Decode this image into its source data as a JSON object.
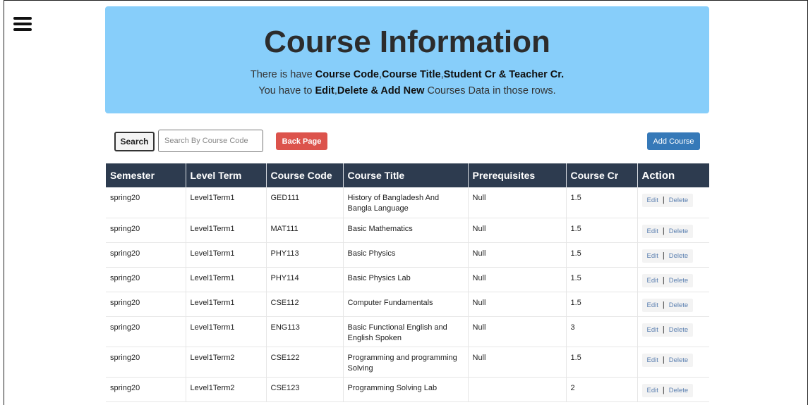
{
  "menu": {
    "icon": "hamburger-menu-icon"
  },
  "hero": {
    "title": "Course Information",
    "line1_pre": "There is have ",
    "line1_b1": "Course Code",
    "line1_c1": ",",
    "line1_b2": "Course Title",
    "line1_c2": ",",
    "line1_b3": "Student Cr & Teacher Cr.",
    "line2_pre": "You have to ",
    "line2_b1": "Edit",
    "line2_c1": ",",
    "line2_b2": "Delete & Add New",
    "line2_post": " Courses Data in those rows."
  },
  "toolbar": {
    "search_label": "Search",
    "search_placeholder": "Search By Course Code",
    "back_label": "Back Page",
    "add_label": "Add Course"
  },
  "table": {
    "headers": [
      "Semester",
      "Level Term",
      "Course Code",
      "Course Title",
      "Prerequisites",
      "Course Cr",
      "Action"
    ],
    "edit_label": "Edit",
    "separator": "|",
    "delete_label": "Delete",
    "rows": [
      {
        "semester": "spring20",
        "level": "Level1Term1",
        "code": "GED111",
        "title": "History of Bangladesh And Bangla Language",
        "prereq": "Null",
        "cr": "1.5"
      },
      {
        "semester": "spring20",
        "level": "Level1Term1",
        "code": "MAT111",
        "title": "Basic Mathematics",
        "prereq": "Null",
        "cr": "1.5"
      },
      {
        "semester": "spring20",
        "level": "Level1Term1",
        "code": "PHY113",
        "title": "Basic Physics",
        "prereq": "Null",
        "cr": "1.5"
      },
      {
        "semester": "spring20",
        "level": "Level1Term1",
        "code": "PHY114",
        "title": "Basic Physics Lab",
        "prereq": "Null",
        "cr": "1.5"
      },
      {
        "semester": "spring20",
        "level": "Level1Term1",
        "code": "CSE112",
        "title": "Computer Fundamentals",
        "prereq": "Null",
        "cr": "1.5"
      },
      {
        "semester": "spring20",
        "level": "Level1Term1",
        "code": "ENG113",
        "title": "Basic Functional English and English Spoken",
        "prereq": "Null",
        "cr": "3"
      },
      {
        "semester": "spring20",
        "level": "Level1Term2",
        "code": "CSE122",
        "title": "Programming and programming Solving",
        "prereq": "Null",
        "cr": "1.5"
      },
      {
        "semester": "spring20",
        "level": "Level1Term2",
        "code": "CSE123",
        "title": "Programming Solving Lab",
        "prereq": "",
        "cr": "2"
      }
    ]
  },
  "colors": {
    "hero_bg": "#87cefa",
    "header_bg": "#2d3b4f",
    "back_button": "#dc534c",
    "add_button": "#3679b8"
  }
}
